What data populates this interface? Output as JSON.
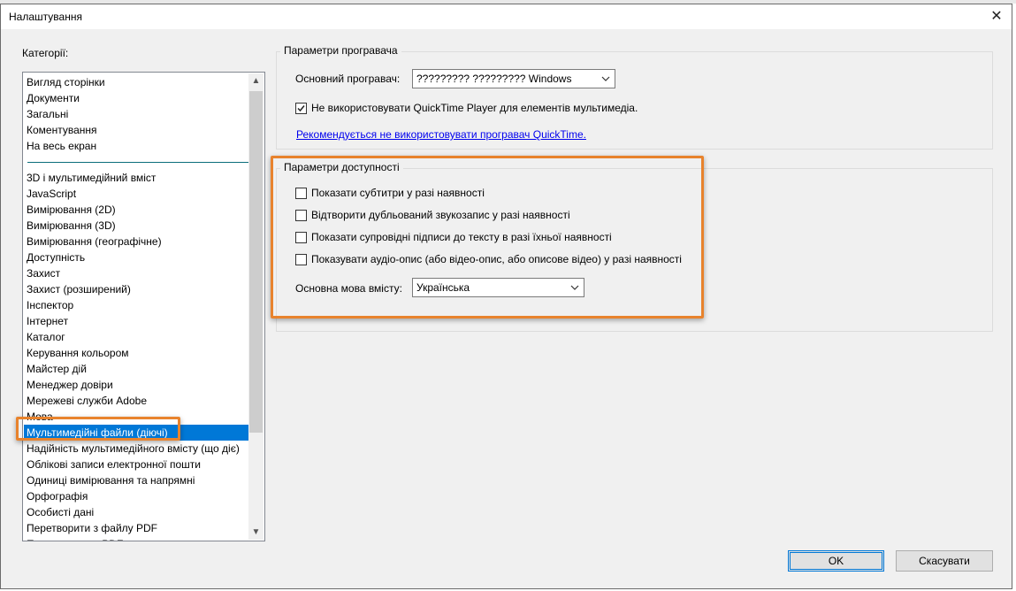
{
  "window": {
    "title": "Налаштування",
    "close_glyph": "✕"
  },
  "categories": {
    "label": "Категорії:",
    "items_top": [
      "Вигляд сторінки",
      "Документи",
      "Загальні",
      "Коментування",
      "На весь екран"
    ],
    "items": [
      "3D і мультимедійний вміст",
      "JavaScript",
      "Вимірювання (2D)",
      "Вимірювання (3D)",
      "Вимірювання (географічне)",
      "Доступність",
      "Захист",
      "Захист (розширений)",
      "Інспектор",
      "Інтернет",
      "Каталог",
      "Керування кольором",
      "Майстер дій",
      "Менеджер довіри",
      "Мережеві служби Adobe",
      "Мова",
      "Мультимедійні файли (діючі)",
      "Надійність мультимедійного вмісту (що діє)",
      "Облікові записи електронної пошти",
      "Одиниці вимірювання та напрямні",
      "Орфографія",
      "Особисті дані",
      "Перетворити з файлу PDF",
      "Перетворити в PDF"
    ],
    "selected_index": 16
  },
  "player": {
    "legend": "Параметри програвача",
    "default_label": "Основний програвач:",
    "default_value": "????????? ????????? Windows",
    "no_quicktime_label": "Не використовувати QuickTime Player для елементів мультимедіа.",
    "no_quicktime_checked": true,
    "link": "Рекомендується не використовувати програвач QuickTime."
  },
  "accessibility": {
    "legend": "Параметри доступності",
    "options": [
      {
        "label": "Показати субтитри у разі наявності",
        "checked": false
      },
      {
        "label": "Відтворити дубльований звукозапис у разі наявності",
        "checked": false
      },
      {
        "label": "Показати супровідні підписи до тексту в разі їхньої наявності",
        "checked": false
      },
      {
        "label": "Показувати аудіо-опис (або відео-опис, або описове відео) у разі наявності",
        "checked": false
      }
    ],
    "language_label": "Основна мова вмісту:",
    "language_value": "Українська"
  },
  "buttons": {
    "ok": "OK",
    "cancel": "Скасувати"
  },
  "colors": {
    "highlight": "#e8832d",
    "selection": "#0078d7",
    "link": "#0000ee"
  }
}
